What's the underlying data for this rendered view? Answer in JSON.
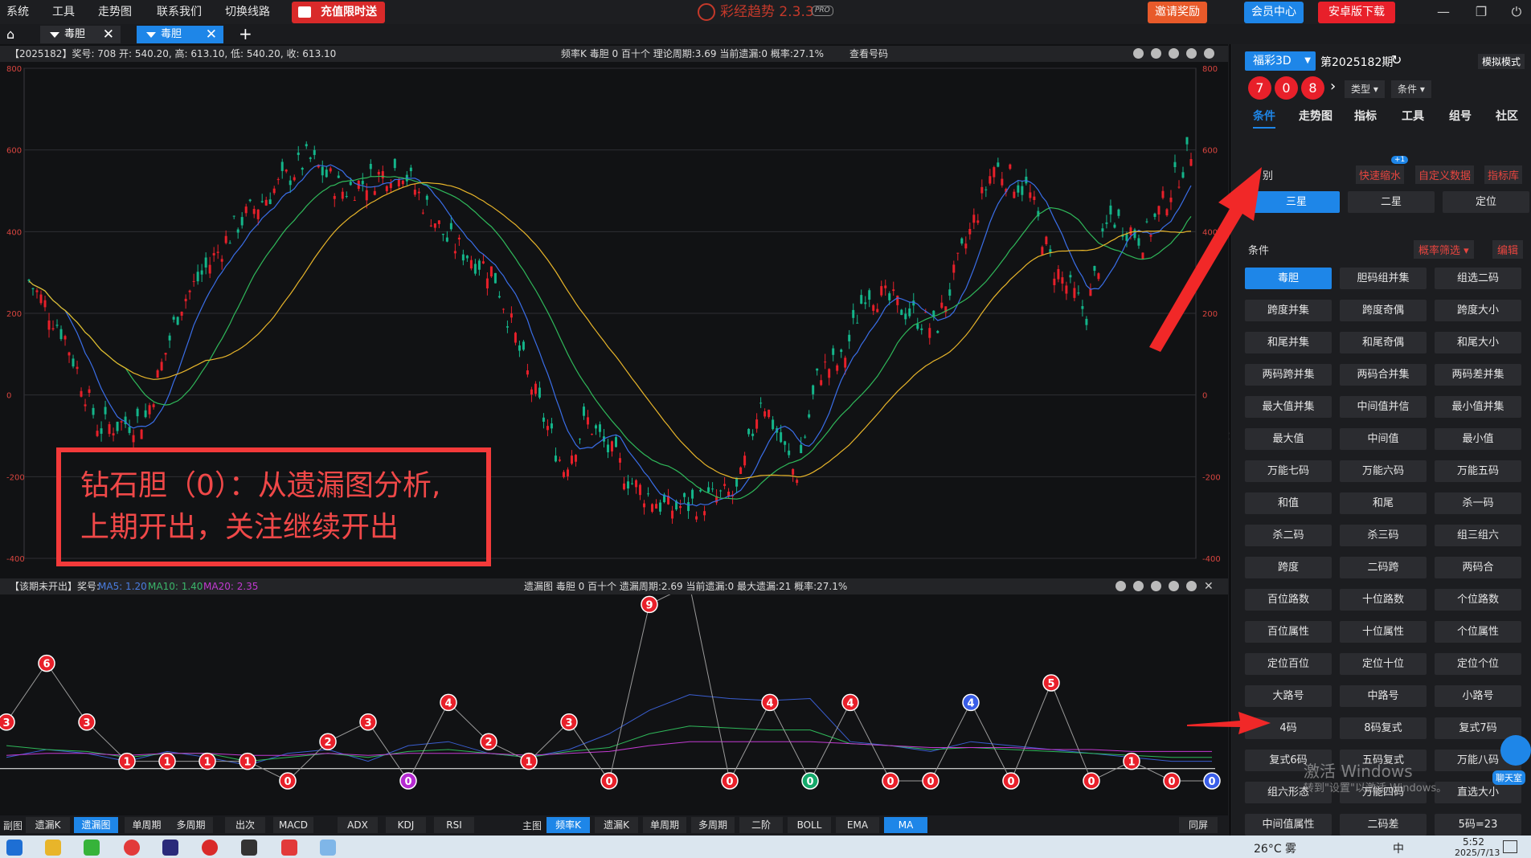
{
  "menu": {
    "items": [
      "系统",
      "工具",
      "走势图",
      "联系我们",
      "切换线路"
    ],
    "promo": "充值限时送"
  },
  "app": {
    "name": "彩经趋势 2.3.3",
    "pro": "PRO"
  },
  "topbar": {
    "invite": "邀请奖励",
    "vip": "会员中心",
    "android": "安卓版下载"
  },
  "tabs": [
    {
      "label": "毒胆"
    },
    {
      "label": "毒胆"
    }
  ],
  "main_chart": {
    "info": "【2025182】奖号: 708  开: 540.20, 高: 613.10, 低: 540.20, 收: 613.10",
    "center": "频率K  毒胆  0  百十个  理论周期:3.69  当前遗漏:0  概率:27.1%",
    "lookup": "查看号码",
    "y_ticks": [
      800,
      600,
      400,
      200,
      0,
      -200,
      -400
    ],
    "ylim": [
      -400,
      800
    ]
  },
  "sub_chart": {
    "info_prefix": "【该期未开出】奖号: ",
    "ma5": "MA5: 1.20",
    "ma10": "MA10: 1.40",
    "ma20": "MA20: 2.35",
    "center": "遗漏图  毒胆  0  百十个  遗漏周期:2.69  当前遗漏:0  最大遗漏:21  概率:27.1%"
  },
  "chart_data": {
    "type": "line",
    "x": [
      1,
      2,
      3,
      4,
      5,
      6,
      7,
      8,
      9,
      10,
      11,
      12,
      13,
      14,
      15,
      16,
      17,
      18,
      19,
      20,
      21,
      22,
      23,
      24,
      25,
      26,
      27,
      28,
      29,
      30,
      31
    ],
    "series": [
      {
        "name": "遗漏",
        "values": [
          3,
          6,
          3,
          1,
          1,
          1,
          1,
          0,
          2,
          3,
          0,
          4,
          2,
          1,
          3,
          0,
          9,
          10,
          0,
          4,
          0,
          4,
          0,
          0,
          4,
          0,
          5,
          0,
          1,
          0,
          0
        ]
      }
    ],
    "ylim": [
      0,
      10
    ]
  },
  "annotation": {
    "line1": "钻石胆（0）：从遗漏图分析,",
    "line2": "上期开出，关注继续开出"
  },
  "sidebar": {
    "lottery": "福彩3D",
    "period": "第2025182期",
    "mode": "模拟模式",
    "balls": [
      "7",
      "0",
      "8"
    ],
    "type": "类型",
    "cond": "条件",
    "tabs": [
      "条件",
      "走势图",
      "指标",
      "工具",
      "组号",
      "社区"
    ],
    "sec1": "别",
    "badge": "+1",
    "quick": "快速缩水",
    "custom": "自定义数据",
    "lib": "指标库",
    "pos": [
      "三星",
      "二星",
      "定位"
    ],
    "sec2": "条件",
    "filter": "概率筛选",
    "edit": "编辑",
    "grid": [
      "毒胆",
      "胆码组并集",
      "组选二码",
      "跨度并集",
      "跨度奇偶",
      "跨度大小",
      "和尾并集",
      "和尾奇偶",
      "和尾大小",
      "两码跨并集",
      "两码合并集",
      "两码差并集",
      "最大值并集",
      "中间值并信",
      "最小值并集",
      "最大值",
      "中间值",
      "最小值",
      "万能七码",
      "万能六码",
      "万能五码",
      "和值",
      "和尾",
      "杀一码",
      "杀二码",
      "杀三码",
      "组三组六",
      "跨度",
      "二码跨",
      "两码合",
      "百位路数",
      "十位路数",
      "个位路数",
      "百位属性",
      "十位属性",
      "个位属性",
      "定位百位",
      "定位十位",
      "定位个位",
      "大路号",
      "中路号",
      "小路号",
      "4码",
      "8码复式",
      "复式7码",
      "复式6码",
      "五码复式",
      "万能八码",
      "组六形态",
      "万能四码",
      "直选大小",
      "中间值属性",
      "二码差",
      "5码=23"
    ],
    "chat": "聊天室"
  },
  "watermark": {
    "line1": "激活 Windows",
    "line2": "转到\"设置\"以激活 Windows。"
  },
  "bottom": {
    "sub": "副图",
    "sub_btns": [
      "遗漏K",
      "遗漏图",
      "单周期",
      "多周期",
      "出次",
      "MACD",
      "ADX",
      "KDJ",
      "RSI"
    ],
    "main": "主图",
    "main_btns": [
      "频率K",
      "遗漏K",
      "单周期",
      "多周期",
      "二阶",
      "BOLL",
      "EMA",
      "MA"
    ],
    "full": "同屏"
  },
  "taskbar": {
    "weather": "26°C 雾",
    "lang": "中",
    "time": "5:52",
    "date": "2025/7/13"
  }
}
